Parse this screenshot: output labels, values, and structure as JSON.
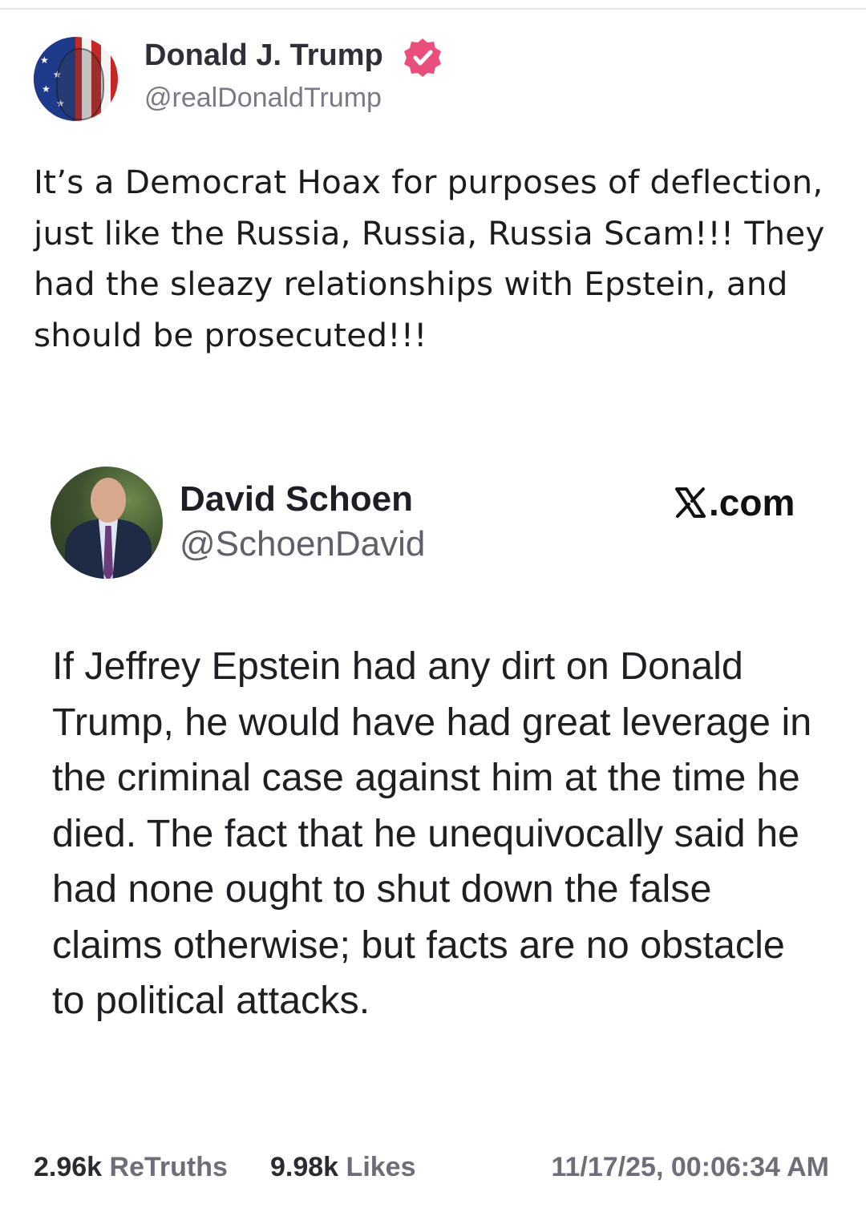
{
  "post": {
    "author": {
      "display_name": "Donald J. Trump",
      "handle": "@realDonaldTrump",
      "verified": true,
      "verified_color": "#e94f7a",
      "avatar_icon": "american-flag-portrait-avatar"
    },
    "text": "It’s a Democrat Hoax for purposes of deflection, just like the Russia, Russia, Russia Scam!!! They had the sleazy relationships with Epstein, and should be prosecuted!!!",
    "quote": {
      "display_name": "David Schoen",
      "handle": "@SchoenDavid",
      "source_label": ".com",
      "source_icon": "x-logo-icon",
      "avatar_icon": "man-in-suit-portrait-avatar",
      "text": "If Jeffrey Epstein had any dirt on Donald Trump, he would have had great leverage in the criminal case against him at the time he died.  The fact that he unequivocally said he had none ought to shut down the false claims otherwise; but facts are no obstacle to political attacks."
    },
    "stats": {
      "retruths_count": "2.96k",
      "retruths_label": "ReTruths",
      "likes_count": "9.98k",
      "likes_label": "Likes",
      "timestamp": "11/17/25, 00:06:34 AM"
    }
  }
}
